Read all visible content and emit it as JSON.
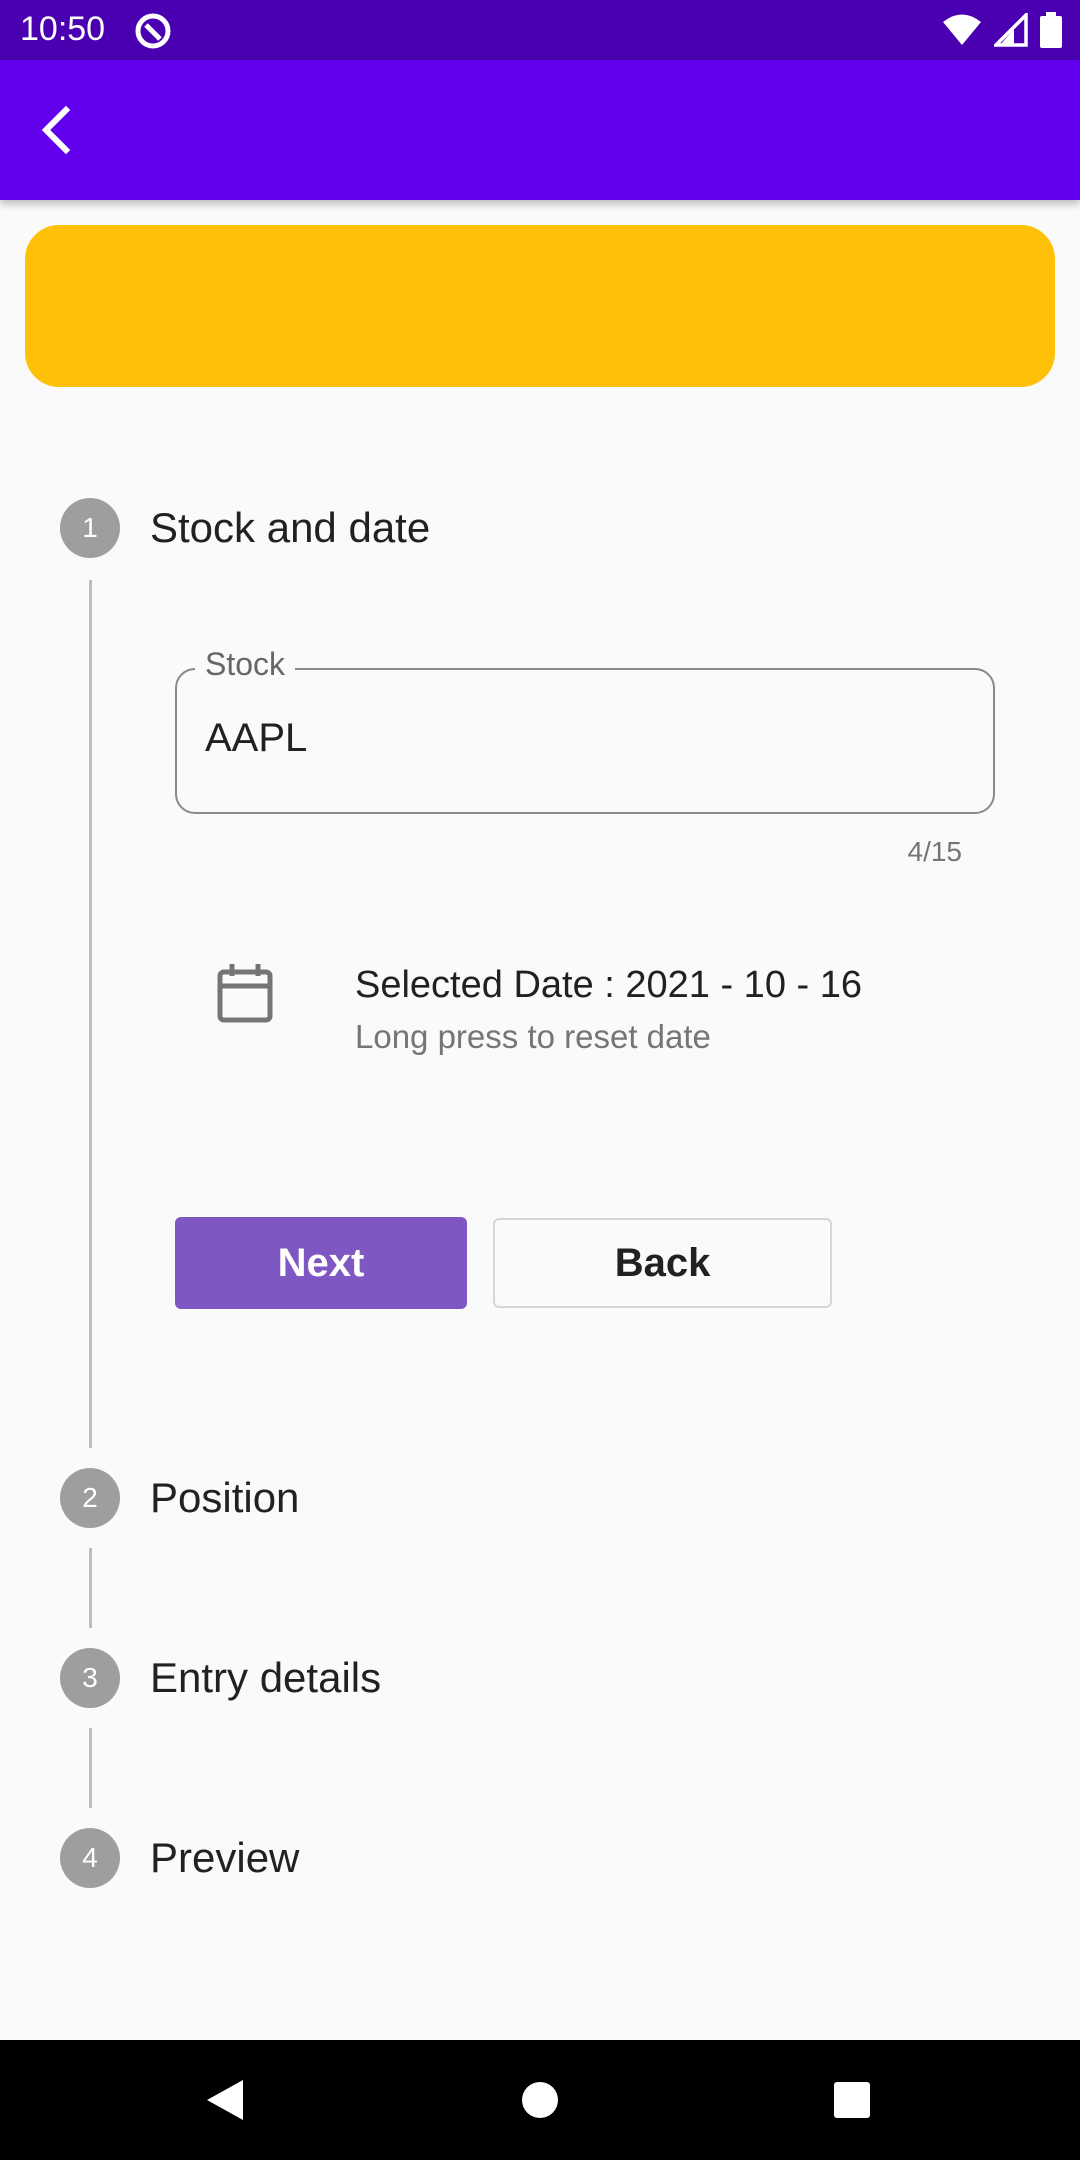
{
  "status_bar": {
    "time": "10:50",
    "icons": [
      "app-notification-icon",
      "wifi-icon",
      "signal-icon",
      "battery-icon"
    ]
  },
  "app_bar": {
    "back_icon": "back-arrow-icon",
    "color": "#6200ee"
  },
  "banner": {
    "color": "#ffc107"
  },
  "steps": [
    {
      "number": "1",
      "title": "Stock and date"
    },
    {
      "number": "2",
      "title": "Position"
    },
    {
      "number": "3",
      "title": "Entry details"
    },
    {
      "number": "4",
      "title": "Preview"
    }
  ],
  "stock_field": {
    "label": "Stock",
    "value": "AAPL",
    "counter": "4/15"
  },
  "date": {
    "icon": "calendar-icon",
    "selected_label": "Selected Date :  2021 - 10 - 16",
    "hint": "Long press to reset date"
  },
  "buttons": {
    "next": "Next",
    "back": "Back",
    "next_color": "#7e57c2"
  },
  "nav_bar": {
    "icons": [
      "nav-back-icon",
      "nav-home-icon",
      "nav-recents-icon"
    ]
  }
}
